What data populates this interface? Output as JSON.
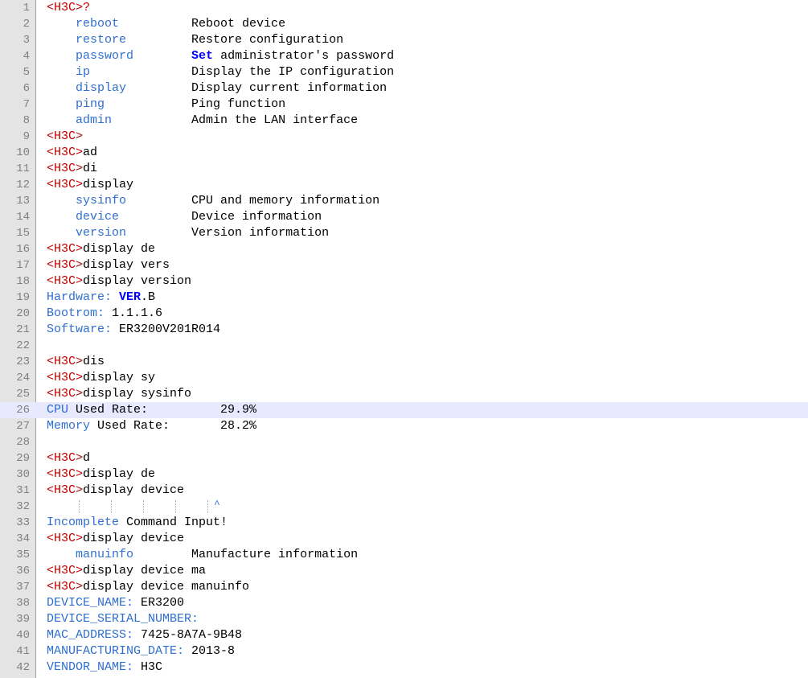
{
  "colors": {
    "prompt": "#c00000",
    "text": "#000000",
    "keyword": "#2f6fd0",
    "bold_keyword": "#0000ff",
    "gutter_bg": "#e4e4e4",
    "line_number": "#808080",
    "current_line_bg": "#e8e8ff"
  },
  "editor": {
    "current_line": 26,
    "lines": [
      {
        "n": "1",
        "segs": [
          [
            "p",
            "<H3C>?"
          ]
        ]
      },
      {
        "n": "2",
        "segs": [
          [
            "t",
            "    "
          ],
          [
            "k",
            "reboot"
          ],
          [
            "t",
            "          Reboot device"
          ]
        ]
      },
      {
        "n": "3",
        "segs": [
          [
            "t",
            "    "
          ],
          [
            "k",
            "restore"
          ],
          [
            "t",
            "         Restore configuration"
          ]
        ]
      },
      {
        "n": "4",
        "segs": [
          [
            "t",
            "    "
          ],
          [
            "k",
            "password"
          ],
          [
            "t",
            "        "
          ],
          [
            "b",
            "Set"
          ],
          [
            "t",
            " administrator's password"
          ]
        ]
      },
      {
        "n": "5",
        "segs": [
          [
            "t",
            "    "
          ],
          [
            "k",
            "ip"
          ],
          [
            "t",
            "              Display the IP configuration"
          ]
        ]
      },
      {
        "n": "6",
        "segs": [
          [
            "t",
            "    "
          ],
          [
            "k",
            "display"
          ],
          [
            "t",
            "         Display current information"
          ]
        ]
      },
      {
        "n": "7",
        "segs": [
          [
            "t",
            "    "
          ],
          [
            "k",
            "ping"
          ],
          [
            "t",
            "            Ping function"
          ]
        ]
      },
      {
        "n": "8",
        "segs": [
          [
            "t",
            "    "
          ],
          [
            "k",
            "admin"
          ],
          [
            "t",
            "           Admin the LAN interface"
          ]
        ]
      },
      {
        "n": "9",
        "segs": [
          [
            "p",
            "<H3C>"
          ]
        ]
      },
      {
        "n": "10",
        "segs": [
          [
            "p",
            "<H3C>"
          ],
          [
            "t",
            "ad"
          ]
        ]
      },
      {
        "n": "11",
        "segs": [
          [
            "p",
            "<H3C>"
          ],
          [
            "t",
            "di"
          ]
        ]
      },
      {
        "n": "12",
        "segs": [
          [
            "p",
            "<H3C>"
          ],
          [
            "t",
            "display"
          ]
        ]
      },
      {
        "n": "13",
        "segs": [
          [
            "t",
            "    "
          ],
          [
            "k",
            "sysinfo"
          ],
          [
            "t",
            "         CPU and memory information"
          ]
        ]
      },
      {
        "n": "14",
        "segs": [
          [
            "t",
            "    "
          ],
          [
            "k",
            "device"
          ],
          [
            "t",
            "          Device information"
          ]
        ]
      },
      {
        "n": "15",
        "segs": [
          [
            "t",
            "    "
          ],
          [
            "k",
            "version"
          ],
          [
            "t",
            "         Version information"
          ]
        ]
      },
      {
        "n": "16",
        "segs": [
          [
            "p",
            "<H3C>"
          ],
          [
            "t",
            "display de"
          ]
        ]
      },
      {
        "n": "17",
        "segs": [
          [
            "p",
            "<H3C>"
          ],
          [
            "t",
            "display vers"
          ]
        ]
      },
      {
        "n": "18",
        "segs": [
          [
            "p",
            "<H3C>"
          ],
          [
            "t",
            "display version"
          ]
        ]
      },
      {
        "n": "19",
        "segs": [
          [
            "k",
            "Hardware:"
          ],
          [
            "t",
            " "
          ],
          [
            "b",
            "VER"
          ],
          [
            "t",
            ".B"
          ]
        ]
      },
      {
        "n": "20",
        "segs": [
          [
            "k",
            "Bootrom:"
          ],
          [
            "t",
            " 1.1.1.6"
          ]
        ]
      },
      {
        "n": "21",
        "segs": [
          [
            "k",
            "Software:"
          ],
          [
            "t",
            " ER3200V201R014"
          ]
        ]
      },
      {
        "n": "22",
        "segs": []
      },
      {
        "n": "23",
        "segs": [
          [
            "p",
            "<H3C>"
          ],
          [
            "t",
            "dis"
          ]
        ]
      },
      {
        "n": "24",
        "segs": [
          [
            "p",
            "<H3C>"
          ],
          [
            "t",
            "display sy"
          ]
        ]
      },
      {
        "n": "25",
        "segs": [
          [
            "p",
            "<H3C>"
          ],
          [
            "t",
            "display sysinfo"
          ]
        ]
      },
      {
        "n": "26",
        "segs": [
          [
            "k",
            "CPU"
          ],
          [
            "t",
            " Used Rate:          29.9%"
          ]
        ]
      },
      {
        "n": "27",
        "segs": [
          [
            "k",
            "Memory"
          ],
          [
            "t",
            " Used Rate:       28.2%"
          ]
        ]
      },
      {
        "n": "28",
        "segs": []
      },
      {
        "n": "29",
        "segs": [
          [
            "p",
            "<H3C>"
          ],
          [
            "t",
            "d"
          ]
        ]
      },
      {
        "n": "30",
        "segs": [
          [
            "p",
            "<H3C>"
          ],
          [
            "t",
            "display de"
          ]
        ]
      },
      {
        "n": "31",
        "segs": [
          [
            "p",
            "<H3C>"
          ],
          [
            "t",
            "display device"
          ]
        ]
      },
      {
        "n": "32",
        "segs": [],
        "caret": "^"
      },
      {
        "n": "33",
        "segs": [
          [
            "k",
            "Incomplete"
          ],
          [
            "t",
            " Command Input!"
          ]
        ]
      },
      {
        "n": "34",
        "segs": [
          [
            "p",
            "<H3C>"
          ],
          [
            "t",
            "display device"
          ]
        ]
      },
      {
        "n": "35",
        "segs": [
          [
            "t",
            "    "
          ],
          [
            "k",
            "manuinfo"
          ],
          [
            "t",
            "        Manufacture information"
          ]
        ]
      },
      {
        "n": "36",
        "segs": [
          [
            "p",
            "<H3C>"
          ],
          [
            "t",
            "display device ma"
          ]
        ]
      },
      {
        "n": "37",
        "segs": [
          [
            "p",
            "<H3C>"
          ],
          [
            "t",
            "display device manuinfo"
          ]
        ]
      },
      {
        "n": "38",
        "segs": [
          [
            "k",
            "DEVICE_NAME:"
          ],
          [
            "t",
            " ER3200"
          ]
        ]
      },
      {
        "n": "39",
        "segs": [
          [
            "k",
            "DEVICE_SERIAL_NUMBER:"
          ]
        ]
      },
      {
        "n": "40",
        "segs": [
          [
            "k",
            "MAC_ADDRESS:"
          ],
          [
            "t",
            " 7425-8A7A-9B48"
          ]
        ]
      },
      {
        "n": "41",
        "segs": [
          [
            "k",
            "MANUFACTURING_DATE:"
          ],
          [
            "t",
            " 2013-8"
          ]
        ]
      },
      {
        "n": "42",
        "segs": [
          [
            "k",
            "VENDOR_NAME:"
          ],
          [
            "t",
            " H3C"
          ]
        ]
      }
    ]
  }
}
